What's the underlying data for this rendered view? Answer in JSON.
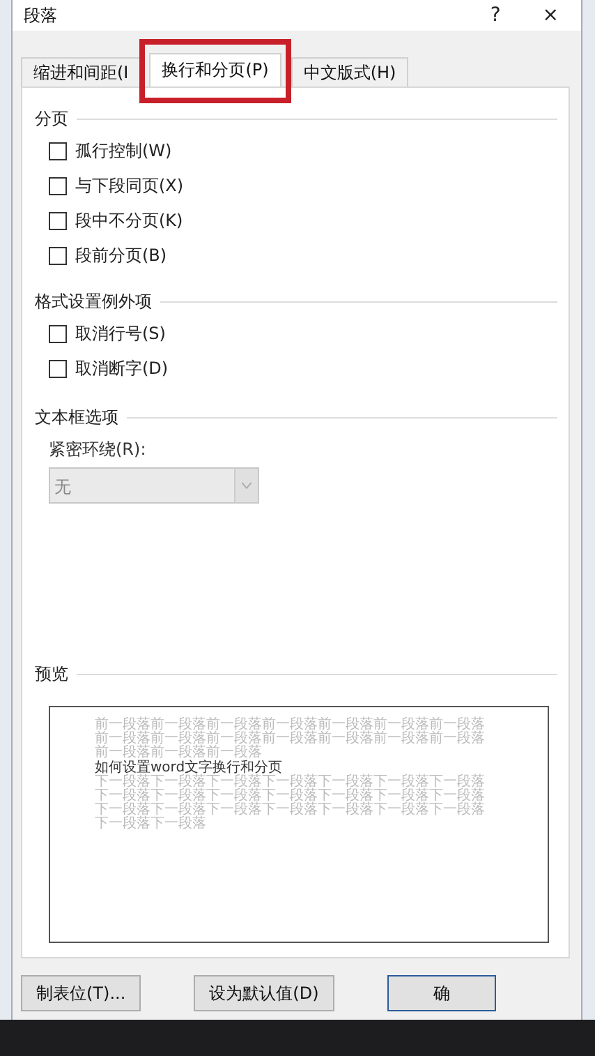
{
  "window": {
    "title": "段落",
    "help": "?",
    "close": "×"
  },
  "tabs": [
    {
      "label": "缩进和间距(I",
      "selected": false
    },
    {
      "label": "换行和分页(P)",
      "selected": true,
      "highlighted": true
    },
    {
      "label": "中文版式(H)",
      "selected": false
    }
  ],
  "sections": [
    {
      "title": "分页",
      "items": [
        {
          "kind": "checkbox",
          "label": "孤行控制(W)",
          "checked": false
        },
        {
          "kind": "checkbox",
          "label": "与下段同页(X)",
          "checked": false
        },
        {
          "kind": "checkbox",
          "label": "段中不分页(K)",
          "checked": false
        },
        {
          "kind": "checkbox",
          "label": "段前分页(B)",
          "checked": false
        }
      ]
    },
    {
      "title": "格式设置例外项",
      "items": [
        {
          "kind": "checkbox",
          "label": "取消行号(S)",
          "checked": false
        },
        {
          "kind": "checkbox",
          "label": "取消断字(D)",
          "checked": false
        }
      ]
    },
    {
      "title": "文本框选项",
      "items": [
        {
          "kind": "select",
          "label": "紧密环绕(R):",
          "value": "无",
          "disabled": true
        }
      ]
    }
  ],
  "preview": {
    "title": "预览",
    "before": "前一段落前一段落前一段落前一段落前一段落前一段落前一段落前一段落前一段落前一段落前一段落前一段落前一段落前一段落前一段落前一段落前一段落",
    "current": "如何设置word文字换行和分页",
    "after": "下一段落下一段落下一段落下一段落下一段落下一段落下一段落下一段落下一段落下一段落下一段落下一段落下一段落下一段落下一段落下一段落下一段落下一段落下一段落下一段落下一段落下一段落下一段落"
  },
  "buttons": [
    "制表位(T)...",
    "设为默认值(D)",
    "确"
  ]
}
